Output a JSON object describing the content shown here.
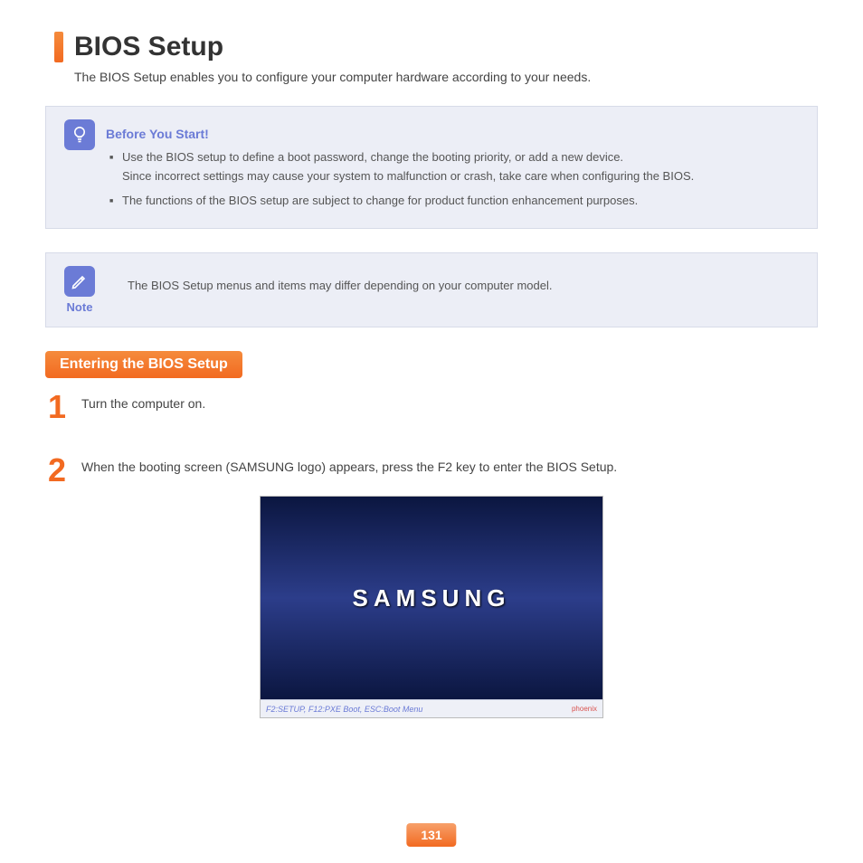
{
  "title": "BIOS Setup",
  "intro": "The BIOS Setup enables you to configure your computer hardware according to your needs.",
  "tip": {
    "title": "Before You Start!",
    "bullets": [
      "Use the BIOS setup to define a boot password, change the booting priority, or add a new device.\nSince incorrect settings may cause your system to malfunction or crash, take care when configuring the BIOS.",
      "The functions of the BIOS setup are subject to change for product function enhancement purposes."
    ]
  },
  "note": {
    "label": "Note",
    "text": "The BIOS Setup menus and items may differ depending on your computer model."
  },
  "section_title": "Entering the BIOS Setup",
  "steps": [
    {
      "num": "1",
      "text": "Turn the computer on."
    },
    {
      "num": "2",
      "text": "When the booting screen (SAMSUNG logo) appears, press the F2 key to enter the BIOS Setup."
    }
  ],
  "boot": {
    "logo": "SAMSUNG",
    "footer_left": "F2:SETUP, F12:PXE Boot, ESC:Boot Menu",
    "footer_right": "phoenix"
  },
  "page_number": "131"
}
